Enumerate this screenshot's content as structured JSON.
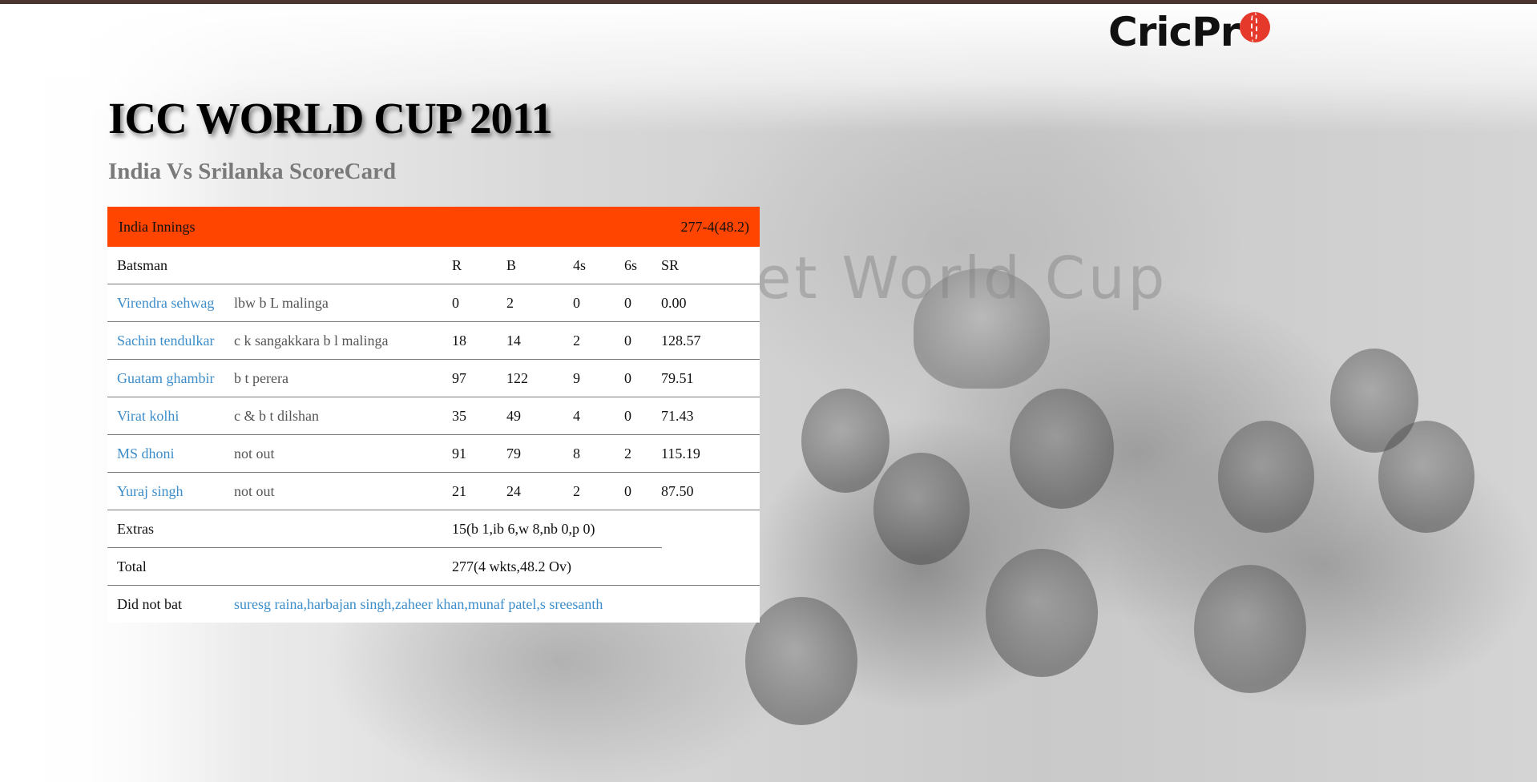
{
  "brand": {
    "logo_text": "CricPr"
  },
  "page": {
    "title": "ICC WORLD CUP 2011",
    "subtitle": "India Vs Srilanka ScoreCard"
  },
  "innings": {
    "team_label": "India Innings",
    "score_summary": "277-4(48.2)",
    "header_color": "#ff4500",
    "columns": {
      "batsman": "Batsman",
      "r": "R",
      "b": "B",
      "fours": "4s",
      "sixes": "6s",
      "sr": "SR"
    },
    "batsmen": [
      {
        "name": "Virendra sehwag",
        "dismissal": "lbw b L malinga",
        "r": "0",
        "b": "2",
        "fours": "0",
        "sixes": "0",
        "sr": "0.00"
      },
      {
        "name": "Sachin tendulkar",
        "dismissal": "c k sangakkara b l malinga",
        "r": "18",
        "b": "14",
        "fours": "2",
        "sixes": "0",
        "sr": "128.57"
      },
      {
        "name": "Guatam ghambir",
        "dismissal": "b t perera",
        "r": "97",
        "b": "122",
        "fours": "9",
        "sixes": "0",
        "sr": "79.51"
      },
      {
        "name": "Virat kolhi",
        "dismissal": "c & b t dilshan",
        "r": "35",
        "b": "49",
        "fours": "4",
        "sixes": "0",
        "sr": "71.43"
      },
      {
        "name": "MS dhoni",
        "dismissal": "not out",
        "r": "91",
        "b": "79",
        "fours": "8",
        "sixes": "2",
        "sr": "115.19"
      },
      {
        "name": "Yuraj singh",
        "dismissal": "not out",
        "r": "21",
        "b": "24",
        "fours": "2",
        "sixes": "0",
        "sr": "87.50"
      }
    ],
    "extras": {
      "label": "Extras",
      "value": "15(b 1,ib 6,w 8,nb 0,p 0)"
    },
    "total": {
      "label": "Total",
      "value": "277(4 wkts,48.2 Ov)"
    },
    "did_not_bat": {
      "label": "Did not bat",
      "value": "suresg raina,harbajan singh,zaheer khan,munaf patel,s sreesanth"
    }
  },
  "colors": {
    "link": "#3c8dc9",
    "top_bar": "#4a3530",
    "accent": "#ff4500"
  }
}
